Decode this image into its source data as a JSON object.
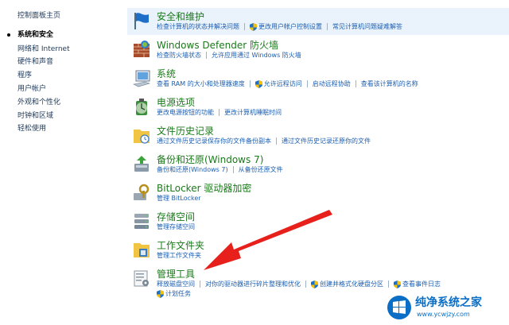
{
  "sidebar": {
    "home": "控制面板主页",
    "items": [
      {
        "label": "系统和安全",
        "current": true
      },
      {
        "label": "网络和 Internet"
      },
      {
        "label": "硬件和声音"
      },
      {
        "label": "程序"
      },
      {
        "label": "用户帐户"
      },
      {
        "label": "外观和个性化"
      },
      {
        "label": "时钟和区域"
      },
      {
        "label": "轻松使用"
      }
    ]
  },
  "categories": [
    {
      "title": "安全和维护",
      "icon": "flag-icon",
      "links": [
        {
          "text": "检查计算机的状态并解决问题"
        },
        {
          "text": "更改用户帐户控制设置",
          "shield": true
        },
        {
          "text": "常见计算机问题疑难解答"
        }
      ]
    },
    {
      "title": "Windows Defender 防火墙",
      "icon": "firewall-icon",
      "links": [
        {
          "text": "检查防火墙状态"
        },
        {
          "text": "允许应用通过 Windows 防火墙"
        }
      ]
    },
    {
      "title": "系统",
      "icon": "computer-icon",
      "links": [
        {
          "text": "查看 RAM 的大小和处理器速度"
        },
        {
          "text": "允许远程访问",
          "shield": true
        },
        {
          "text": "启动远程协助"
        },
        {
          "text": "查看该计算机的名称"
        }
      ]
    },
    {
      "title": "电源选项",
      "icon": "battery-icon",
      "links": [
        {
          "text": "更改电源按钮的功能"
        },
        {
          "text": "更改计算机睡眠时间"
        }
      ]
    },
    {
      "title": "文件历史记录",
      "icon": "file-history-icon",
      "links": [
        {
          "text": "通过文件历史记录保存你的文件备份副本"
        },
        {
          "text": "通过文件历史记录还原你的文件"
        }
      ]
    },
    {
      "title": "备份和还原(Windows 7)",
      "icon": "backup-icon",
      "links": [
        {
          "text": "备份和还原(Windows 7)"
        },
        {
          "text": "从备份还原文件"
        }
      ]
    },
    {
      "title": "BitLocker 驱动器加密",
      "icon": "bitlocker-icon",
      "links": [
        {
          "text": "管理 BitLocker"
        }
      ]
    },
    {
      "title": "存储空间",
      "icon": "storage-icon",
      "links": [
        {
          "text": "管理存储空间"
        }
      ]
    },
    {
      "title": "工作文件夹",
      "icon": "work-folders-icon",
      "links": [
        {
          "text": "管理工作文件夹"
        }
      ]
    },
    {
      "title": "管理工具",
      "icon": "admin-tools-icon",
      "links": [
        {
          "text": "释放磁盘空间"
        },
        {
          "text": "对你的驱动器进行碎片整理和优化"
        },
        {
          "text": "创建并格式化硬盘分区",
          "shield": true
        },
        {
          "text": "查看事件日志",
          "shield": true
        }
      ],
      "links2": [
        {
          "text": "计划任务",
          "shield": true
        }
      ]
    }
  ],
  "watermark": {
    "title": "纯净系统之家",
    "url": "www.ycwjzy.com"
  },
  "colors": {
    "title_green": "#1a7a1a",
    "link_blue": "#1c5fb2",
    "arrow_red": "#e8201c"
  }
}
